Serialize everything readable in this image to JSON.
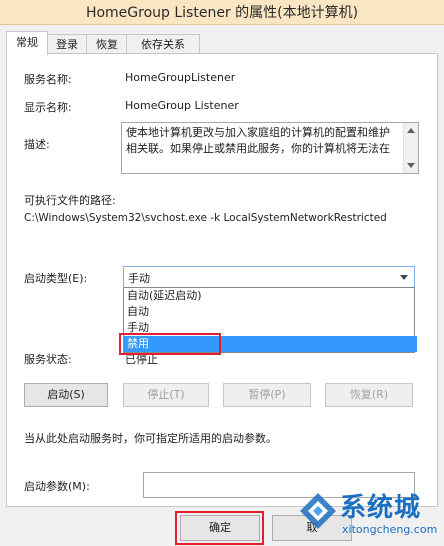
{
  "window": {
    "title": "HomeGroup Listener 的属性(本地计算机)"
  },
  "tabs": [
    {
      "label": "常规",
      "active": true
    },
    {
      "label": "登录",
      "active": false
    },
    {
      "label": "恢复",
      "active": false
    },
    {
      "label": "依存关系",
      "active": false
    }
  ],
  "general": {
    "service_name_label": "服务名称:",
    "service_name": "HomeGroupListener",
    "display_name_label": "显示名称:",
    "display_name": "HomeGroup Listener",
    "description_label": "描述:",
    "description": "使本地计算机更改与加入家庭组的计算机的配置和维护相关联。如果停止或禁用此服务，你的计算机将无法在",
    "exe_path_label": "可执行文件的路径:",
    "exe_path": "C:\\Windows\\System32\\svchost.exe -k LocalSystemNetworkRestricted",
    "startup_type_label": "启动类型(E):",
    "startup_type_value": "手动",
    "startup_options": [
      "自动(延迟启动)",
      "自动",
      "手动",
      "禁用"
    ],
    "highlighted_option": "禁用",
    "service_status_label": "服务状态:",
    "service_status": "已停止",
    "buttons": {
      "start": "启动(S)",
      "stop": "停止(T)",
      "pause": "暂停(P)",
      "resume": "恢复(R)"
    },
    "hint": "当从此处启动服务时，你可指定所适用的启动参数。",
    "start_params_label": "启动参数(M):",
    "start_params_value": ""
  },
  "footer": {
    "ok": "确定",
    "cancel": "取"
  },
  "watermark": {
    "text": "系统城",
    "url": "xitongcheng.com"
  },
  "colors": {
    "highlight": "#3399ff",
    "annotation": "#e0212f",
    "titlebar": "#fbe6c4"
  }
}
